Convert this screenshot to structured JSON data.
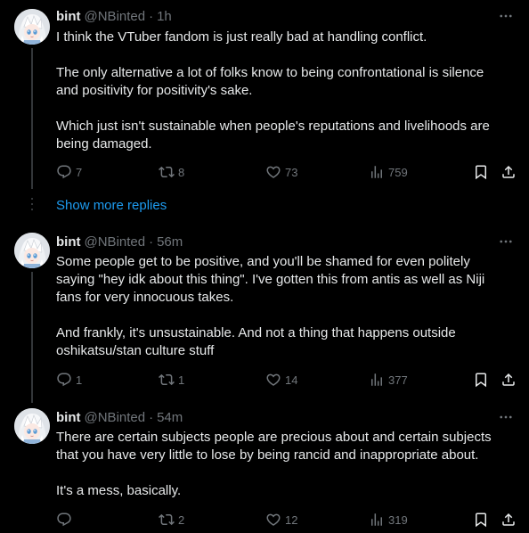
{
  "tweets": [
    {
      "author_name": "bint",
      "author_handle": "@NBinted",
      "separator": "·",
      "time": "1h",
      "paragraphs": [
        "I think the VTuber fandom is just really bad at handling conflict.",
        "The only alternative a lot of folks know to being confrontational is silence\nand positivity for positivity's sake.",
        "Which just isn't sustainable when people's reputations and livelihoods are\nbeing damaged."
      ],
      "replies": "7",
      "reposts": "8",
      "likes": "73",
      "views": "759"
    },
    {
      "author_name": "bint",
      "author_handle": "@NBinted",
      "separator": "·",
      "time": "56m",
      "paragraphs": [
        "Some people get to be positive, and you'll be shamed for even politely\nsaying \"hey idk about this thing\". I've gotten this from antis as well as Niji\nfans for very innocuous takes.",
        "And frankly, it's unsustainable. And not a thing that happens outside\noshikatsu/stan culture stuff"
      ],
      "replies": "1",
      "reposts": "1",
      "likes": "14",
      "views": "377"
    },
    {
      "author_name": "bint",
      "author_handle": "@NBinted",
      "separator": "·",
      "time": "54m",
      "paragraphs": [
        "There are certain subjects people are precious about and certain subjects\nthat you have very little to lose by being rancid and inappropriate about.",
        "It's a mess, basically."
      ],
      "replies": "",
      "reposts": "2",
      "likes": "12",
      "views": "319"
    }
  ],
  "show_more_label": "Show more replies",
  "colors": {
    "background": "#000000",
    "text": "#e7e9ea",
    "muted": "#71767b",
    "link": "#1d9bf0"
  },
  "icons": [
    "avatar-illustration",
    "more-dots-icon",
    "reply-icon",
    "repost-icon",
    "like-icon",
    "views-icon",
    "bookmark-icon",
    "share-icon"
  ]
}
